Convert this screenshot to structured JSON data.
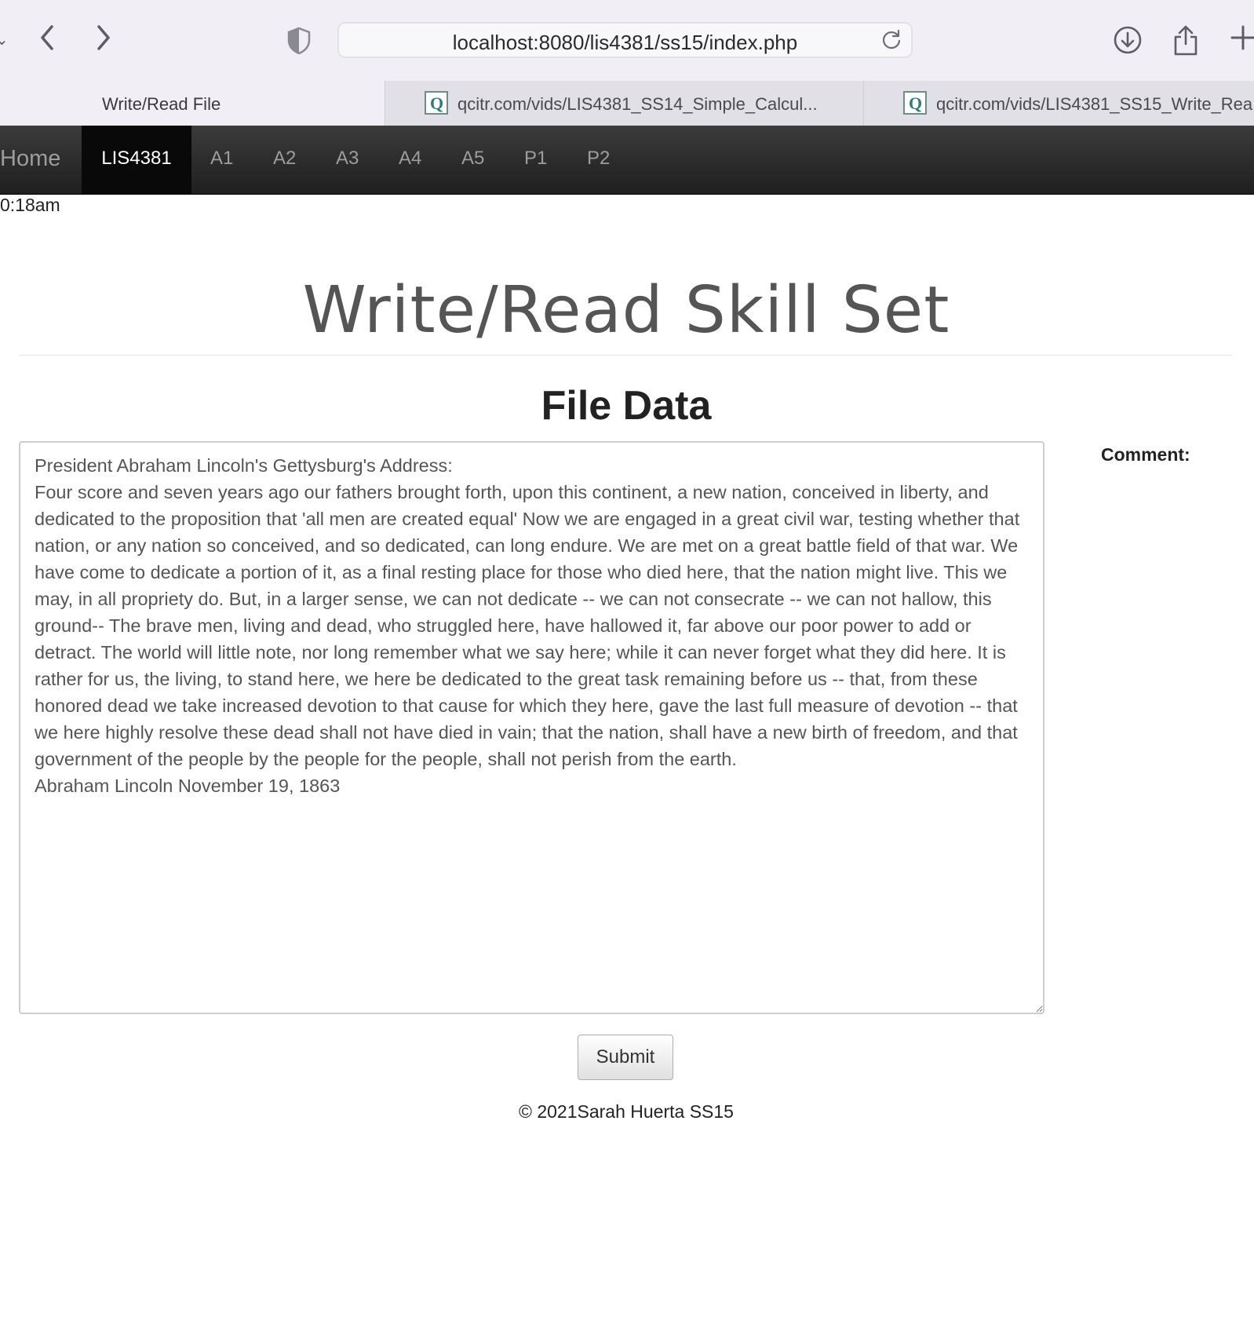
{
  "browser": {
    "url": "localhost:8080/lis4381/ss15/index.php",
    "tabs": [
      {
        "title": "Write/Read File",
        "active": true
      },
      {
        "title": "qcitr.com/vids/LIS4381_SS14_Simple_Calcul...",
        "active": false,
        "favicon": "Q"
      },
      {
        "title": "qcitr.com/vids/LIS4381_SS15_Write_Rea",
        "active": false,
        "favicon": "Q"
      }
    ],
    "icons": {
      "back": "chevron-left-icon",
      "forward": "chevron-right-icon",
      "privacy": "shield-icon",
      "reload": "reload-icon",
      "download": "download-icon",
      "share": "share-icon",
      "new_tab": "plus-icon"
    }
  },
  "navbar": {
    "brand": "Home",
    "items": [
      "LIS4381",
      "A1",
      "A2",
      "A3",
      "A4",
      "A5",
      "P1",
      "P2"
    ],
    "active": "LIS4381"
  },
  "clock": "0:18am",
  "page": {
    "title": "Write/Read Skill Set",
    "section_title": "File Data",
    "file_text": "President Abraham Lincoln's Gettysburg's Address:\nFour score and seven years ago our fathers brought forth, upon this continent, a new nation, conceived in liberty, and dedicated to the proposition that 'all men are created equal' Now we are engaged in a great civil war, testing whether that nation, or any nation so conceived, and so dedicated, can long endure. We are met on a great battle field of that war. We have come to dedicate a portion of it, as a final resting place for those who died here, that the nation might live. This we may, in all propriety do. But, in a larger sense, we can not dedicate -- we can not consecrate -- we can not hallow, this ground-- The brave men, living and dead, who struggled here, have hallowed it, far above our poor power to add or detract. The world will little note, nor long remember what we say here; while it can never forget what they did here. It is rather for us, the living, to stand here, we here be dedicated to the great task remaining before us -- that, from these honored dead we take increased devotion to that cause for which they here, gave the last full measure of devotion -- that we here highly resolve these dead shall not have died in vain; that the nation, shall have a new birth of freedom, and that government of the people by the people for the people, shall not perish from the earth.\nAbraham Lincoln November 19, 1863",
    "comment_label": "Comment:",
    "submit_label": "Submit",
    "footer": "© 2021Sarah Huerta SS15"
  },
  "colors": {
    "navbar_bg": "#222222",
    "navbar_active_bg": "#080808",
    "title": "#555555",
    "chrome_bg": "#f1eff5"
  }
}
